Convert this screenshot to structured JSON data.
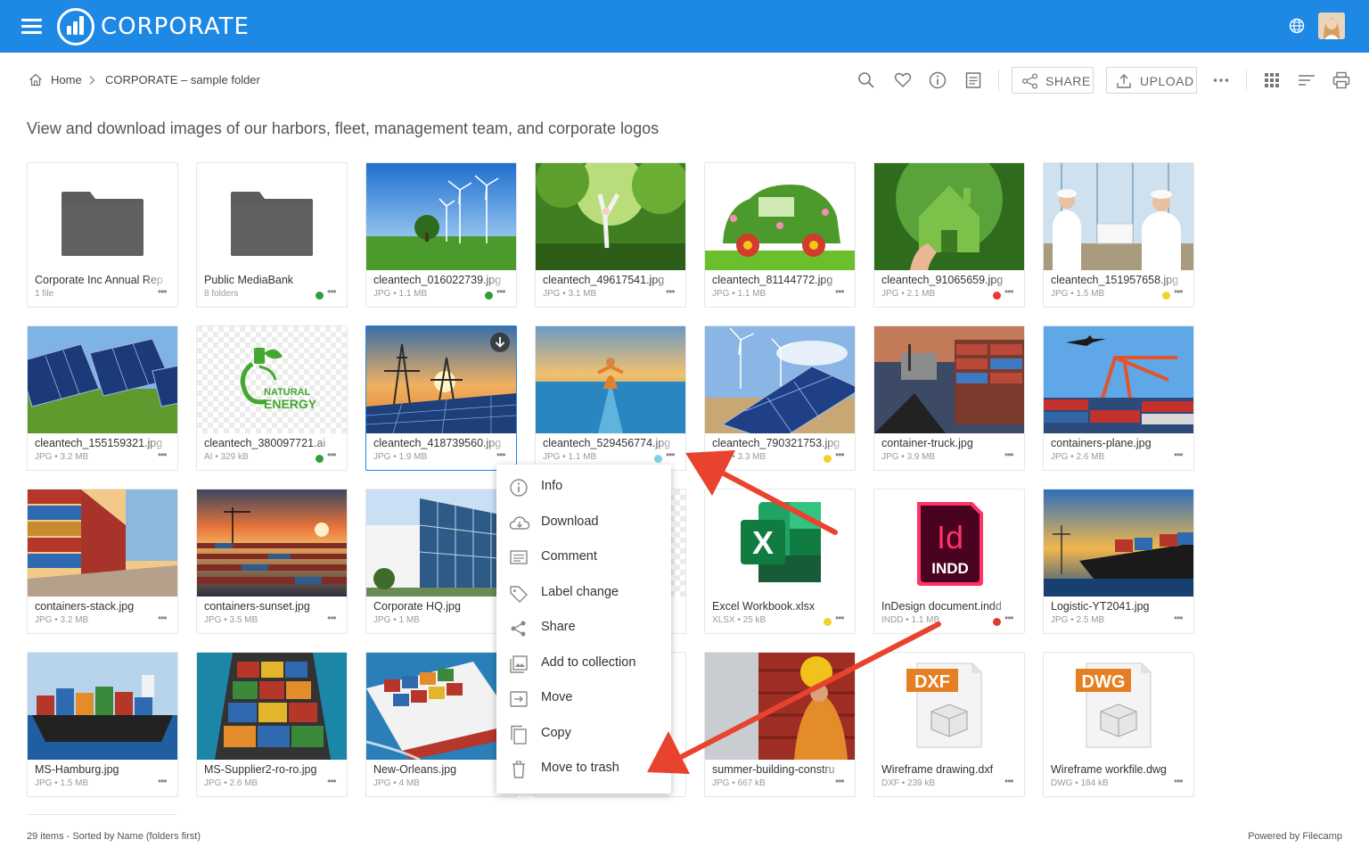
{
  "header": {
    "brand": "CORPORATE"
  },
  "breadcrumb": {
    "home": "Home",
    "current": "CORPORATE – sample folder"
  },
  "toolbar": {
    "share_label": "SHARE",
    "upload_label": "UPLOAD"
  },
  "page": {
    "description": "View and download images of our harbors, fleet, management team, and corporate logos"
  },
  "tiles": [
    {
      "name": "Corporate Inc Annual Rep",
      "meta": "1 file"
    },
    {
      "name": "Public MediaBank",
      "meta": "8 folders",
      "label_color": "#2e9e3a"
    },
    {
      "name": "cleantech_016022739.jpg",
      "meta": "JPG • 1.1 MB",
      "label_color": "#2e9e3a"
    },
    {
      "name": "cleantech_49617541.jpg",
      "meta": "JPG • 3.1 MB"
    },
    {
      "name": "cleantech_81144772.jpg",
      "meta": "JPG • 1.1 MB"
    },
    {
      "name": "cleantech_91065659.jpg",
      "meta": "JPG • 2.1 MB",
      "label_color": "#e53935"
    },
    {
      "name": "cleantech_151957658.jpg",
      "meta": "JPG • 1.5 MB",
      "label_color": "#f2d22c"
    },
    {
      "name": "cleantech_155159321.jpg",
      "meta": "JPG • 3.2 MB"
    },
    {
      "name": "cleantech_380097721.ai",
      "meta": "AI • 329 kB",
      "label_color": "#2e9e3a"
    },
    {
      "name": "cleantech_418739560.jpg",
      "meta": "JPG • 1.9 MB"
    },
    {
      "name": "cleantech_529456774.jpg",
      "meta": "JPG • 1.1 MB",
      "label_color": "#7fd3e8"
    },
    {
      "name": "cleantech_790321753.jpg",
      "meta": "JPG • 3.3 MB",
      "label_color": "#f2d22c"
    },
    {
      "name": "container-truck.jpg",
      "meta": "JPG • 3.9 MB"
    },
    {
      "name": "containers-plane.jpg",
      "meta": "JPG • 2.6 MB"
    },
    {
      "name": "containers-stack.jpg",
      "meta": "JPG • 3.2 MB"
    },
    {
      "name": "containers-sunset.jpg",
      "meta": "JPG • 3.5 MB"
    },
    {
      "name": "Corporate HQ.jpg",
      "meta": "JPG • 1 MB"
    },
    {
      "name": "",
      "meta": ""
    },
    {
      "name": "Excel Workbook.xlsx",
      "meta": "XLSX • 25 kB",
      "label_color": "#f2d22c"
    },
    {
      "name": "InDesign document.indd",
      "meta": "INDD • 1.1 MB",
      "label_color": "#e53935"
    },
    {
      "name": "Logistic-YT2041.jpg",
      "meta": "JPG • 2.5 MB"
    },
    {
      "name": "MS-Hamburg.jpg",
      "meta": "JPG • 1.5 MB"
    },
    {
      "name": "MS-Supplier2-ro-ro.jpg",
      "meta": "JPG • 2.6 MB"
    },
    {
      "name": "New-Orleans.jpg",
      "meta": "JPG • 4 MB"
    },
    {
      "name": "",
      "meta": ""
    },
    {
      "name": "summer-building-constru",
      "meta": "JPG • 667 kB"
    },
    {
      "name": "Wireframe drawing.dxf",
      "meta": "DXF • 239 kB"
    },
    {
      "name": "Wireframe workfile.dwg",
      "meta": "DWG • 184 kB"
    }
  ],
  "icons": {
    "ai_line1": "NATURAL",
    "ai_line2": "ENERGY",
    "indd_letters": "Id",
    "indd_ext": "INDD",
    "excel_letter": "X",
    "dxf": "DXF",
    "dwg": "DWG"
  },
  "context_menu": {
    "items": [
      "Info",
      "Download",
      "Comment",
      "Label change",
      "Share",
      "Add to collection",
      "Move",
      "Copy",
      "Move to trash"
    ]
  },
  "footer": {
    "status": "29 items - Sorted by Name (folders first)",
    "powered": "Powered by Filecamp"
  },
  "colors": {
    "header_bg": "#1e88e5",
    "annotation_arrow": "#e8432e"
  }
}
